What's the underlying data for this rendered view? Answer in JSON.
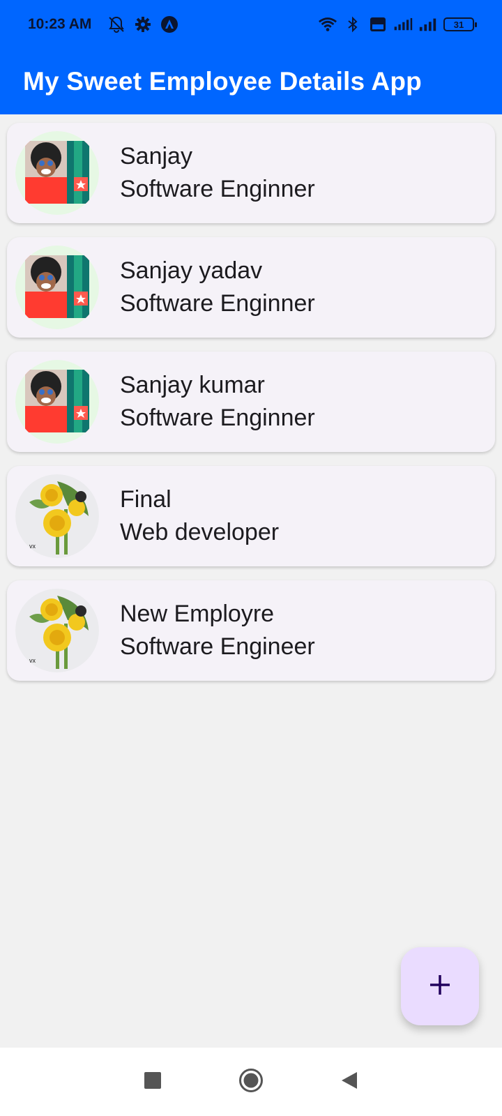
{
  "status_bar": {
    "time": "10:23 AM",
    "battery_level": "31",
    "icons": [
      "notifications-off-icon",
      "gear-icon",
      "app-notification-icon",
      "wifi-icon",
      "bluetooth-icon",
      "volte-icon",
      "signal-4g-icon",
      "signal-icon",
      "battery-icon"
    ]
  },
  "app_bar": {
    "title": "My Sweet Employee Details App",
    "background": "#0066ff"
  },
  "employees": [
    {
      "name": "Sanjay",
      "role": "Software Enginner",
      "avatar": "person-photo"
    },
    {
      "name": "Sanjay yadav",
      "role": "Software Enginner",
      "avatar": "person-photo"
    },
    {
      "name": "Sanjay kumar",
      "role": "Software Enginner",
      "avatar": "person-photo"
    },
    {
      "name": "Final",
      "role": "Web developer",
      "avatar": "sunflower-photo"
    },
    {
      "name": "New Employre",
      "role": "Software Engineer",
      "avatar": "sunflower-photo"
    }
  ],
  "fab": {
    "label": "+",
    "icon": "add-icon",
    "color": "#eadcff"
  },
  "nav_bar": {
    "icons": [
      "recents-square-icon",
      "home-circle-icon",
      "back-triangle-icon"
    ]
  }
}
